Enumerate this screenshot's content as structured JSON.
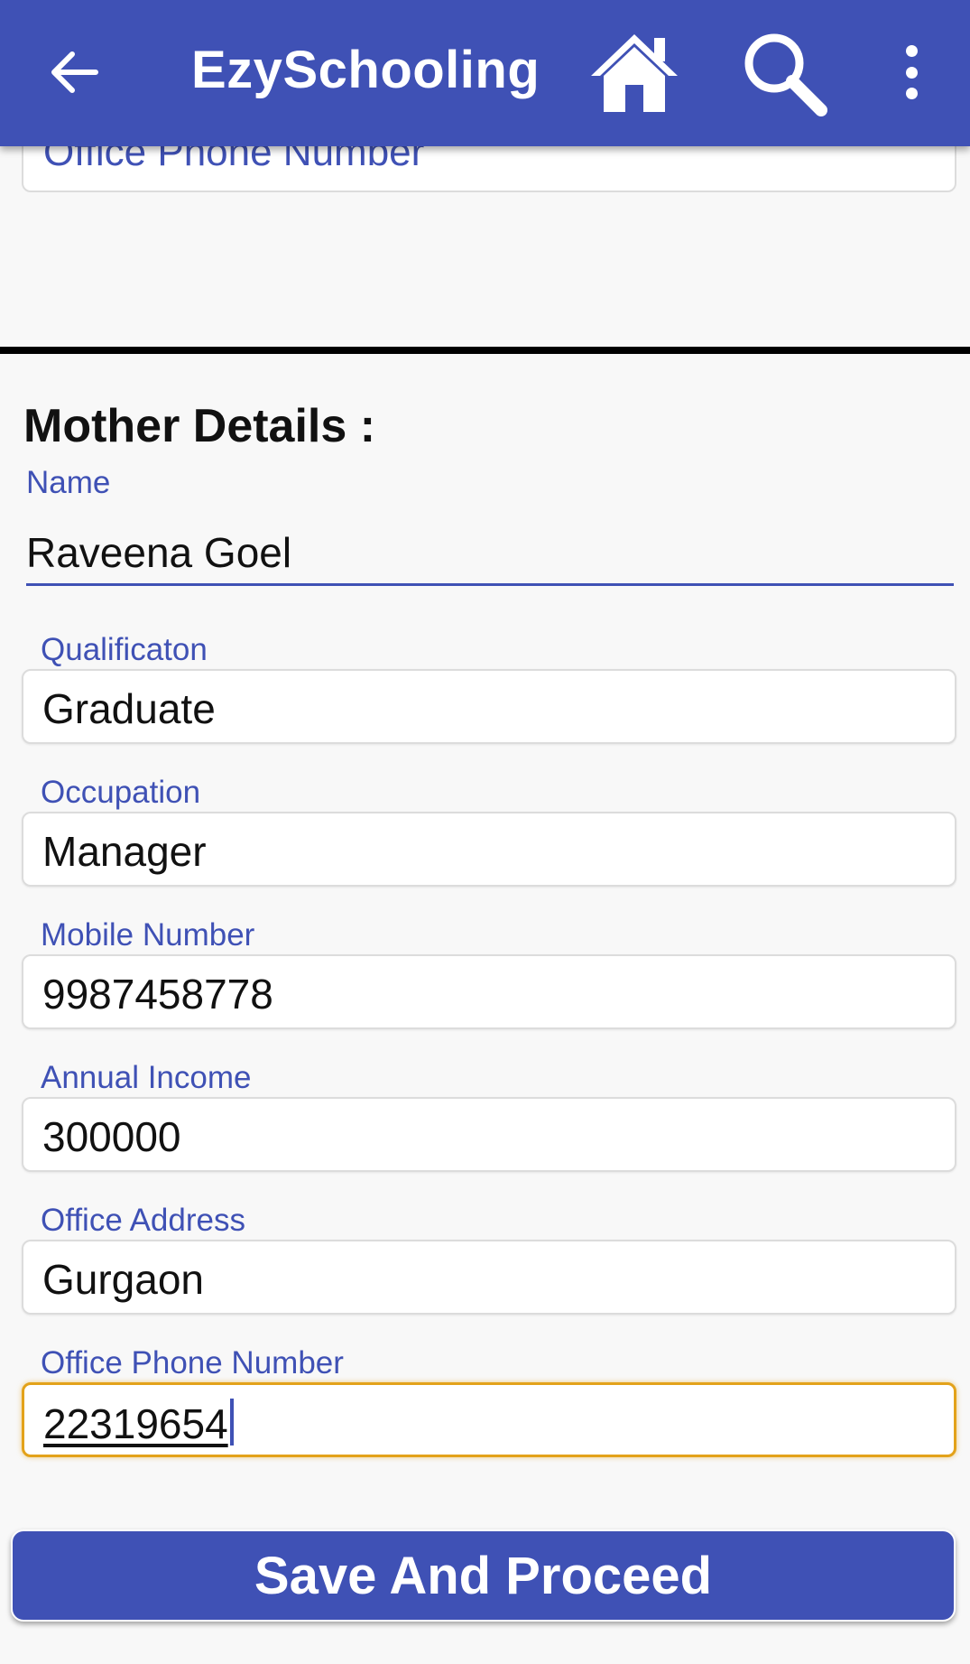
{
  "app_bar": {
    "title": "EzySchooling",
    "icons": [
      "back-arrow-icon",
      "home-icon",
      "search-icon",
      "more-vert-icon"
    ],
    "color": "#3f51b5"
  },
  "previous_field": {
    "placeholder": "Office Phone Number"
  },
  "mother_details": {
    "heading": "Mother Details :",
    "name": {
      "label": "Name",
      "value": "Raveena Goel"
    },
    "qualification": {
      "label": "Qualificaton",
      "value": "Graduate"
    },
    "occupation": {
      "label": "Occupation",
      "value": "Manager"
    },
    "mobile": {
      "label": "Mobile Number",
      "value": "9987458778"
    },
    "income": {
      "label": "Annual Income",
      "value": "300000"
    },
    "office_address": {
      "label": "Office Address",
      "value": "Gurgaon"
    },
    "office_phone": {
      "label": "Office Phone Number",
      "value": "22319654"
    }
  },
  "actions": {
    "save_label": "Save And Proceed"
  },
  "colors": {
    "accent": "#3f51b5",
    "focus_border": "#e3a21a"
  }
}
